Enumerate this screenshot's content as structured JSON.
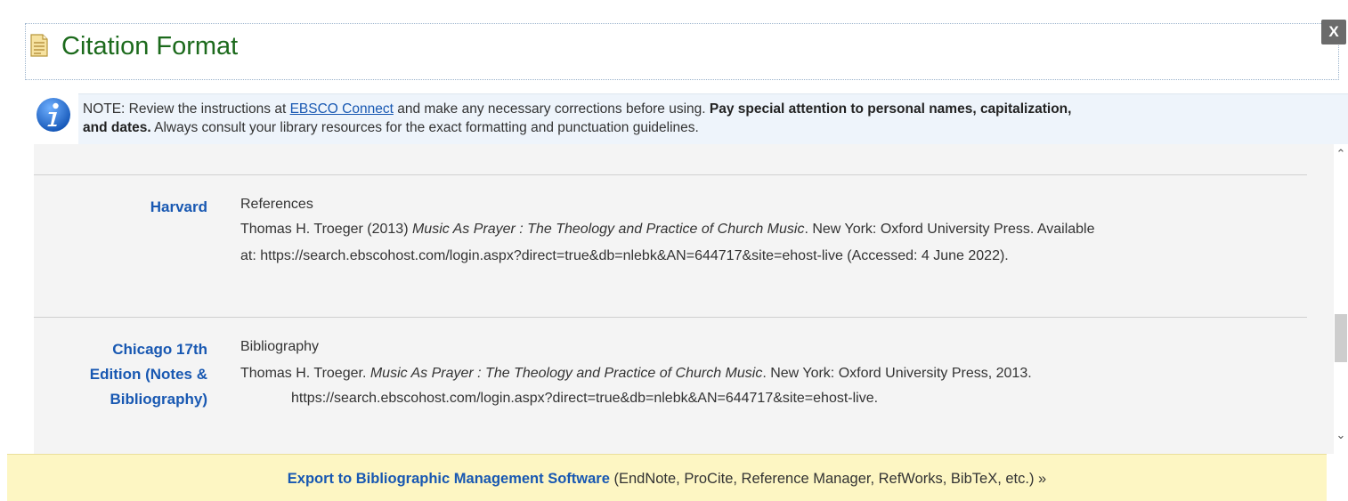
{
  "header": {
    "title": "Citation Format",
    "close_label": "X"
  },
  "note": {
    "prefix": "NOTE: Review the instructions at ",
    "link": "EBSCO Connect",
    "middle": " and make any necessary corrections before using. ",
    "bold1": "Pay special attention to personal names, capitalization,",
    "bold2": "and dates.",
    "suffix": " Always consult your library resources for the exact formatting and punctuation guidelines."
  },
  "citations": [
    {
      "style_name": "Harvard",
      "heading": "References",
      "lines": [
        {
          "pre": "Thomas H. Troeger (2013) ",
          "title": "Music As Prayer : The Theology and Practice of Church Music",
          "post": ". New York: Oxford University Press. Available"
        },
        {
          "text": "at: https://search.ebscohost.com/login.aspx?direct=true&db=nlebk&AN=644717&site=ehost-live (Accessed: 4 June 2022)."
        }
      ]
    },
    {
      "style_name_lines": [
        "Chicago 17th",
        "Edition (Notes &",
        "Bibliography)"
      ],
      "heading": "Bibliography",
      "lines": [
        {
          "pre": "Thomas H. Troeger. ",
          "title": "Music As Prayer : The Theology and Practice of Church Music",
          "post": ". New York: Oxford University Press, 2013."
        },
        {
          "text": "https://search.ebscohost.com/login.aspx?direct=true&db=nlebk&AN=644717&site=ehost-live."
        }
      ]
    }
  ],
  "footer": {
    "export_link": "Export to Bibliographic Management Software",
    "export_rest": " (EndNote, ProCite, Reference Manager, RefWorks, BibTeX, etc.) »"
  },
  "icons": {
    "document": "document-icon",
    "info": "info-icon",
    "scroll_up": "chevron-up-icon",
    "scroll_down": "chevron-down-icon"
  },
  "colors": {
    "title_green": "#1c6a1c",
    "link_blue": "#1858b2",
    "note_bg": "#eef4fb",
    "footer_bg": "#fdf6c3",
    "close_bg": "#6b6b6b"
  }
}
